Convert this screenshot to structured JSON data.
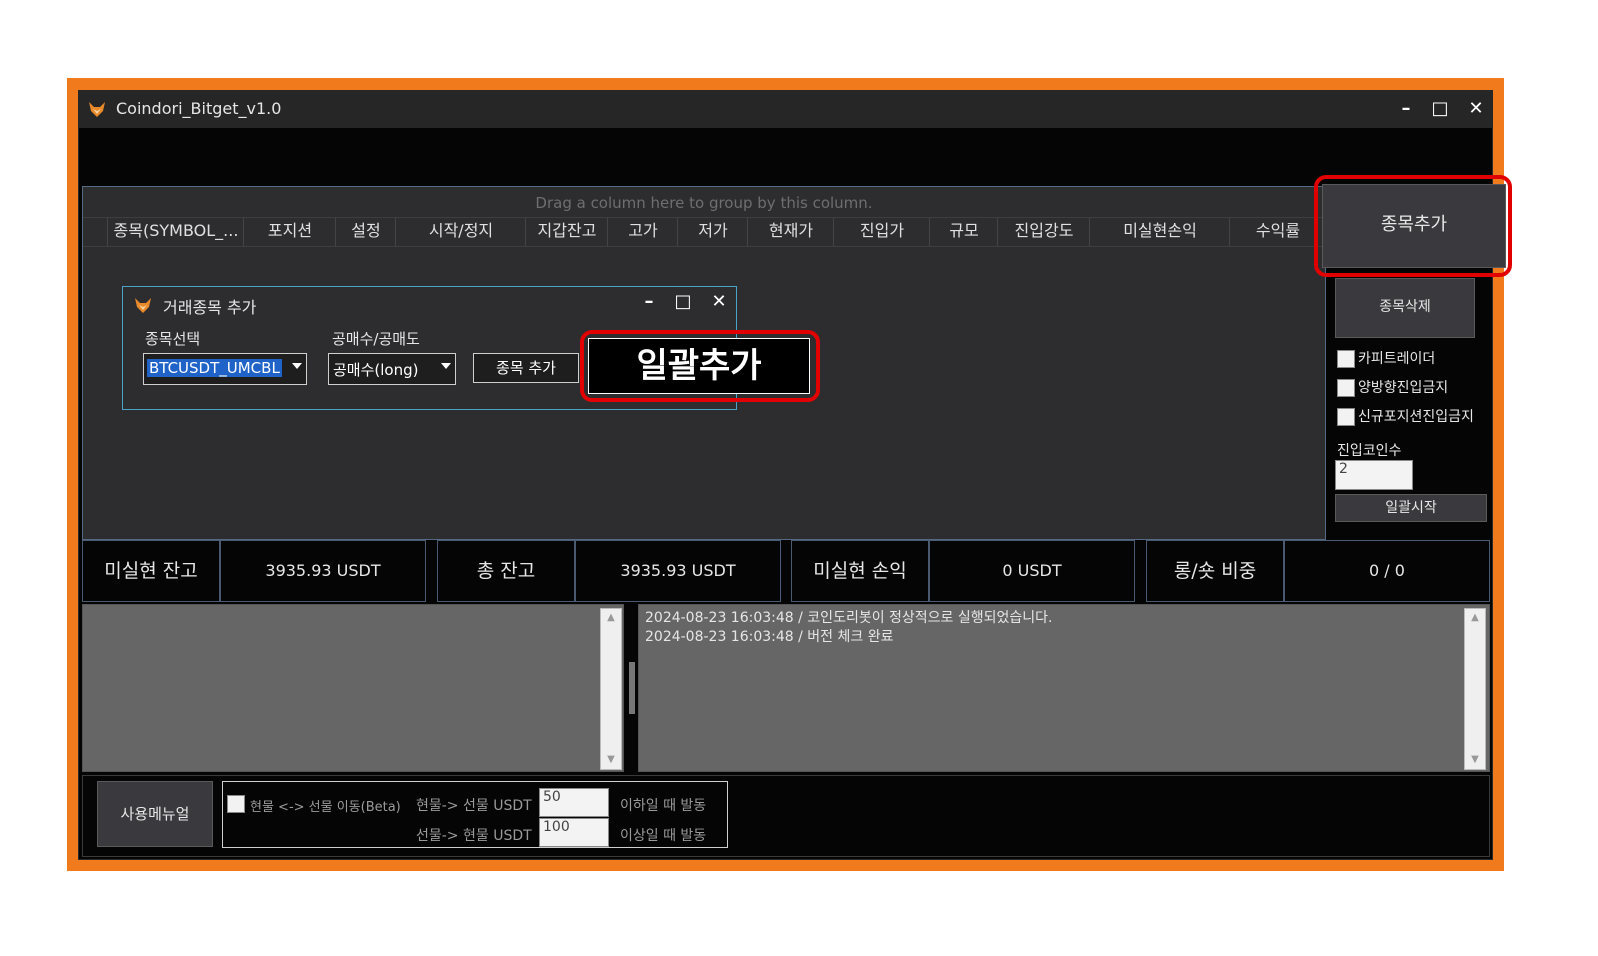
{
  "window": {
    "title": "Coindori_Bitget_v1.0",
    "min": "–",
    "max": "□",
    "close": "✕",
    "icon": "fox-logo-icon"
  },
  "grid": {
    "group_hint": "Drag a column here to group by this column.",
    "columns": [
      "종목(SYMBOL_...",
      "포지션",
      "설정",
      "시작/정지",
      "지갑잔고",
      "고가",
      "저가",
      "현재가",
      "진입가",
      "규모",
      "진입강도",
      "미실현손익",
      "수익률"
    ]
  },
  "side": {
    "add_symbol": "종목추가",
    "delete_symbol": "종목삭제",
    "checkboxes": [
      "카피트레이더",
      "양방향진입금지",
      "신규포지션진입금지"
    ],
    "entry_coin_label": "진입코인수",
    "entry_coin_value": "2",
    "batch_start": "일괄시작"
  },
  "dialog": {
    "title": "거래종목 추가",
    "min": "–",
    "max": "□",
    "close": "✕",
    "symbol_label": "종목선택",
    "symbol_value": "BTCUSDT_UMCBL",
    "side_label": "공매수/공매도",
    "side_value": "공매수(long)",
    "add_button": "종목 추가",
    "batch_add_button": "일괄추가"
  },
  "stats": [
    {
      "label": "미실현 잔고",
      "value": "3935.93 USDT"
    },
    {
      "label": "총 잔고",
      "value": "3935.93 USDT"
    },
    {
      "label": "미실현 손익",
      "value": "0 USDT"
    },
    {
      "label": "롱/숏 비중",
      "value": "0 / 0"
    }
  ],
  "log": [
    "2024-08-23 16:03:48 / 코인도리봇이 정상적으로 실행되었습니다.",
    "2024-08-23 16:03:48 / 버전 체크 완료"
  ],
  "bottom": {
    "manual_button": "사용메뉴얼",
    "transfer_check_label": "현물 <-> 선물 이동(Beta)",
    "spot_to_futures_label": "현물-> 선물 USDT",
    "spot_to_futures_value": "50",
    "spot_to_futures_suffix": "이하일 때 발동",
    "futures_to_spot_label": "선물-> 현물 USDT",
    "futures_to_spot_value": "100",
    "futures_to_spot_suffix": "이상일 때 발동"
  },
  "colors": {
    "frame": "#f07a1c",
    "highlight": "#e00000",
    "window": "#050505",
    "panel": "#2d2d30"
  }
}
